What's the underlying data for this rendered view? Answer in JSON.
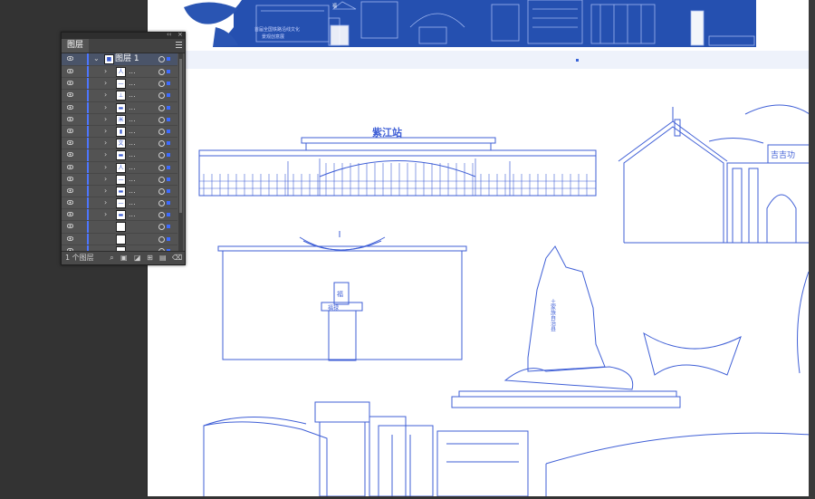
{
  "panel": {
    "tab_label": "图层",
    "collapse_glyph": "‹‹",
    "close_glyph": "×",
    "footer_label": "1 个图层",
    "footer_icons": [
      "search-icon",
      "export-icon",
      "clipping-mask-icon",
      "new-sublayer-icon",
      "new-layer-icon",
      "delete-icon"
    ],
    "main_layer": {
      "name": "图层 1",
      "thumb": "■"
    },
    "sublayers": [
      {
        "name": "...",
        "thumb": "人"
      },
      {
        "name": "...",
        "thumb": "—"
      },
      {
        "name": "...",
        "thumb": "⊥"
      },
      {
        "name": "...",
        "thumb": "▬"
      },
      {
        "name": "...",
        "thumb": "米"
      },
      {
        "name": "...",
        "thumb": "▮"
      },
      {
        "name": "...",
        "thumb": "文"
      },
      {
        "name": "...",
        "thumb": "▬"
      },
      {
        "name": "...",
        "thumb": "人"
      },
      {
        "name": "...",
        "thumb": "—"
      },
      {
        "name": "...",
        "thumb": "▬"
      },
      {
        "name": "...",
        "thumb": "—"
      },
      {
        "name": "...",
        "thumb": "▬"
      },
      {
        "name": "",
        "thumb": ""
      },
      {
        "name": "",
        "thumb": ""
      },
      {
        "name": "",
        "thumb": ""
      }
    ]
  },
  "artwork": {
    "station_sign": "紫江站",
    "gate_sign": "吉吉功",
    "monument_text": "土家族自治县",
    "pavilion_sign": "福",
    "wall_plaque": "福禄",
    "banner_text_1": "首届全国铁路沿线文化",
    "banner_text_2": "景观创意展",
    "accent_color": "#3f5fd6",
    "banner_color": "#1f4ea8"
  }
}
